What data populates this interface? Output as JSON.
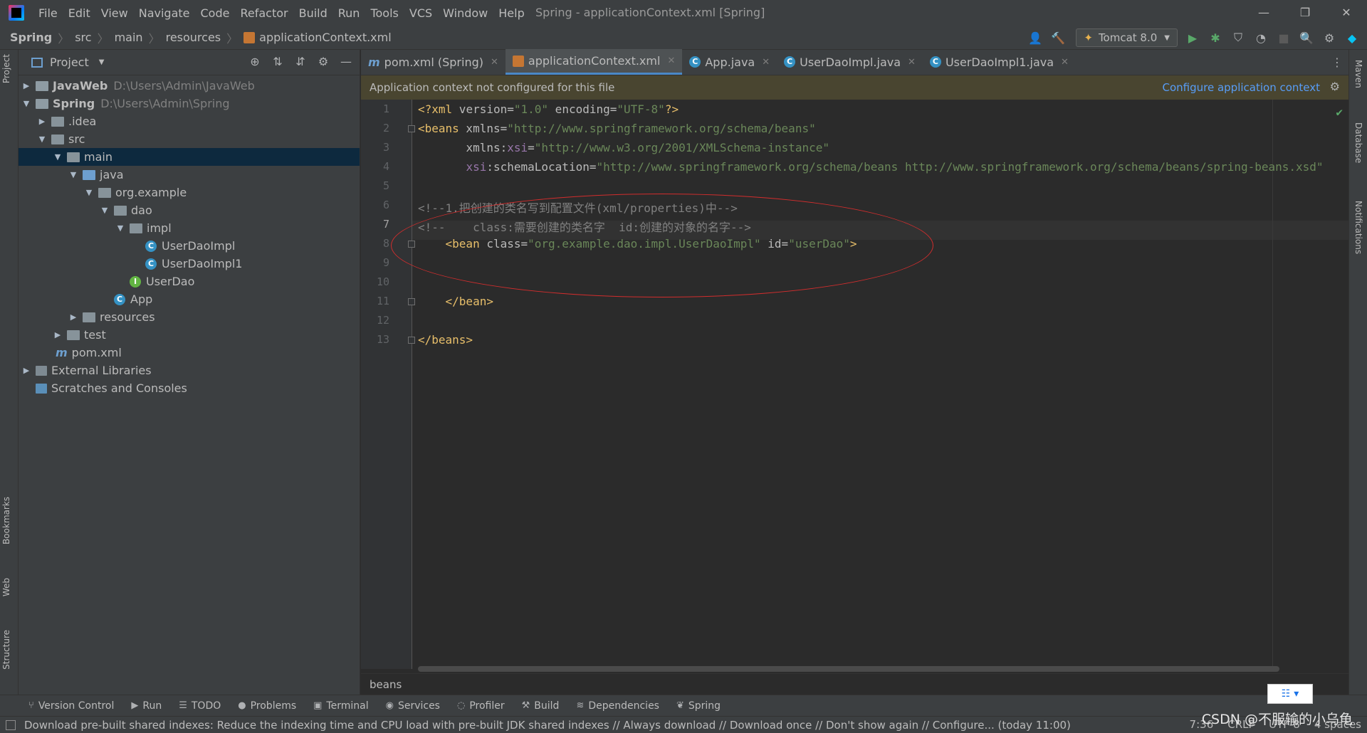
{
  "menu": [
    "File",
    "Edit",
    "View",
    "Navigate",
    "Code",
    "Refactor",
    "Build",
    "Run",
    "Tools",
    "VCS",
    "Window",
    "Help"
  ],
  "window_title": "Spring - applicationContext.xml [Spring]",
  "window_controls": {
    "minimize": "—",
    "restore": "❐",
    "close": "✕"
  },
  "breadcrumbs": [
    "Spring",
    "src",
    "main",
    "resources",
    "applicationContext.xml"
  ],
  "run_config": "Tomcat 8.0",
  "left_strip": {
    "project": "Project",
    "bookmarks": "Bookmarks",
    "web": "Web",
    "structure": "Structure"
  },
  "right_strip": {
    "maven": "Maven",
    "database": "Database",
    "notifications": "Notifications"
  },
  "project_panel": {
    "title": "Project",
    "tree": [
      {
        "label": "JavaWeb",
        "path": "D:\\Users\\Admin\\JavaWeb"
      },
      {
        "label": "Spring",
        "path": "D:\\Users\\Admin\\Spring"
      },
      {
        "label": ".idea"
      },
      {
        "label": "src"
      },
      {
        "label": "main"
      },
      {
        "label": "java"
      },
      {
        "label": "org.example"
      },
      {
        "label": "dao"
      },
      {
        "label": "impl"
      },
      {
        "label": "UserDaoImpl"
      },
      {
        "label": "UserDaoImpl1"
      },
      {
        "label": "UserDao"
      },
      {
        "label": "App"
      },
      {
        "label": "resources"
      },
      {
        "label": "test"
      },
      {
        "label": "pom.xml"
      },
      {
        "label": "External Libraries"
      },
      {
        "label": "Scratches and Consoles"
      }
    ]
  },
  "tabs": [
    "pom.xml (Spring)",
    "applicationContext.xml",
    "App.java",
    "UserDaoImpl.java",
    "UserDaoImpl1.java"
  ],
  "banner": {
    "message": "Application context not configured for this file",
    "action": "Configure application context"
  },
  "code": {
    "line_numbers": [
      "1",
      "2",
      "3",
      "4",
      "5",
      "6",
      "7",
      "8",
      "9",
      "10",
      "11",
      "12",
      "13"
    ],
    "l1": {
      "a": "<?xml",
      "b": " version=",
      "c": "\"1.0\"",
      "d": " encoding=",
      "e": "\"UTF-8\"",
      "f": "?>"
    },
    "l2": {
      "a": "<beans",
      "b": " xmlns=",
      "c": "\"http://www.springframework.org/schema/beans\""
    },
    "l3": {
      "indent": "       ",
      "a": "xmlns",
      "b": ":",
      "c": "xsi",
      "d": "=",
      "e": "\"http://www.w3.org/2001/XMLSchema-instance\""
    },
    "l4": {
      "indent": "       ",
      "a": "xsi",
      "b": ":schemaLocation=",
      "c": "\"http://www.springframework.org/schema/beans http://www.springframework.org/schema/beans/spring-beans.xsd\""
    },
    "l6": "<!--1.把创建的类名写到配置文件(xml/properties)中-->",
    "l7": "<!--    class:需要创建的类名字  id:创建的对象的名字-->",
    "l8": {
      "indent": "    ",
      "a": "<bean",
      "b": " class=",
      "c": "\"org.example.dao.impl.UserDaoImpl\"",
      "d": " id=",
      "e": "\"userDao\"",
      "f": ">"
    },
    "l11": {
      "indent": "    ",
      "a": "</bean>"
    },
    "l13": {
      "a": "</beans>"
    }
  },
  "editor_breadcrumb": "beans",
  "bottom_tools": [
    "Version Control",
    "Run",
    "TODO",
    "Problems",
    "Terminal",
    "Services",
    "Profiler",
    "Build",
    "Dependencies",
    "Spring"
  ],
  "status": {
    "message": "Download pre-built shared indexes: Reduce the indexing time and CPU load with pre-built JDK shared indexes // Always download // Download once // Don't show again // Configure... (today 11:00)",
    "position": "7:36",
    "line_sep": "CRLF",
    "encoding": "UTF-8",
    "indent": "4 spaces"
  },
  "watermark": "CSDN @不服输的小乌龟",
  "colors": {
    "tag": "#e8bf6a",
    "value": "#6a8759",
    "comment": "#808080",
    "ns": "#9876aa",
    "link": "#589df6",
    "selection": "#0d293e",
    "annotation": "#d22d2d"
  }
}
